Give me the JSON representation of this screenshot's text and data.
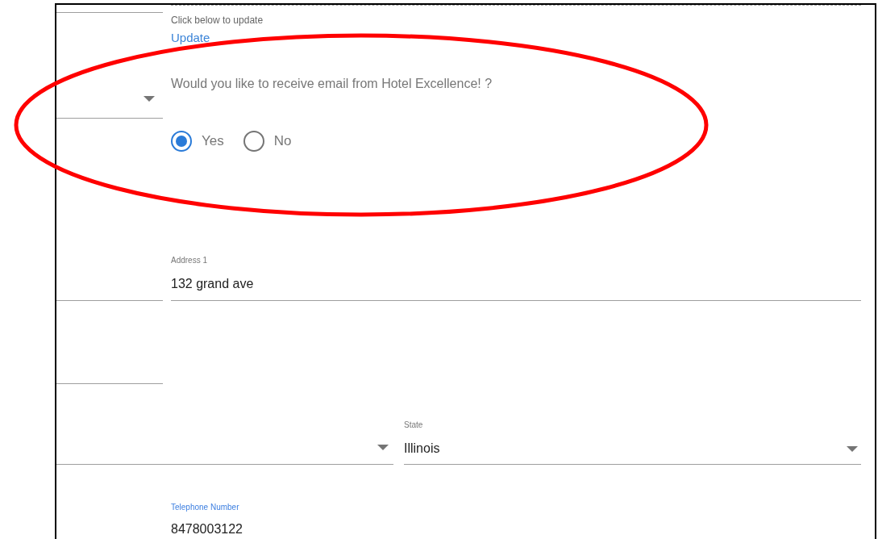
{
  "update_section": {
    "hint": "Click below to update",
    "link": "Update"
  },
  "email_question": {
    "question": "Would you like to receive email from Hotel Excellence! ?",
    "options": [
      {
        "label": "Yes",
        "selected": true
      },
      {
        "label": "No",
        "selected": false
      }
    ]
  },
  "address1": {
    "label": "Address 1",
    "value": "132 grand ave"
  },
  "state": {
    "label": "State",
    "value": "Illinois"
  },
  "telephone": {
    "label": "Telephone Number",
    "value": "8478003122",
    "focused": true
  }
}
